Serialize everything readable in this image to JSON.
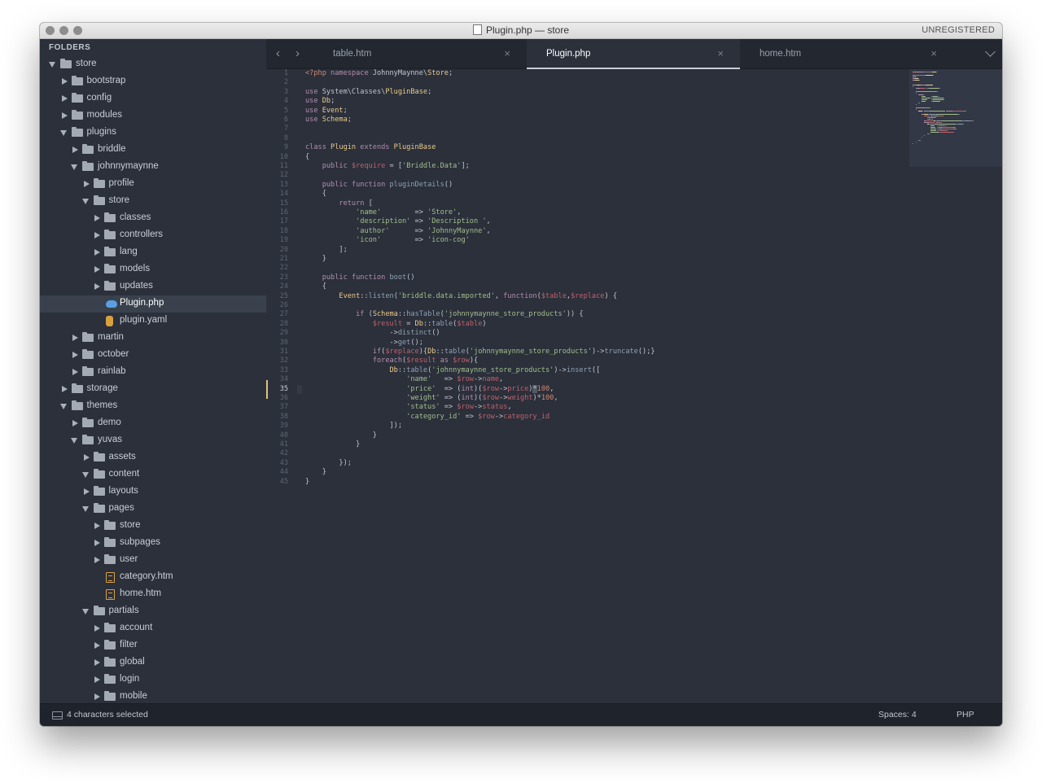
{
  "window": {
    "title": "Plugin.php — store",
    "registration": "UNREGISTERED"
  },
  "sidebar": {
    "header": "FOLDERS",
    "items": [
      {
        "label": "store",
        "depth": 0,
        "kind": "folder",
        "state": "open"
      },
      {
        "label": "bootstrap",
        "depth": 1,
        "kind": "folder",
        "state": "closed"
      },
      {
        "label": "config",
        "depth": 1,
        "kind": "folder",
        "state": "closed"
      },
      {
        "label": "modules",
        "depth": 1,
        "kind": "folder",
        "state": "closed"
      },
      {
        "label": "plugins",
        "depth": 1,
        "kind": "folder",
        "state": "open"
      },
      {
        "label": "briddle",
        "depth": 2,
        "kind": "folder",
        "state": "closed"
      },
      {
        "label": "johnnymaynne",
        "depth": 2,
        "kind": "folder",
        "state": "open"
      },
      {
        "label": "profile",
        "depth": 3,
        "kind": "folder",
        "state": "closed"
      },
      {
        "label": "store",
        "depth": 3,
        "kind": "folder",
        "state": "open"
      },
      {
        "label": "classes",
        "depth": 4,
        "kind": "folder",
        "state": "closed"
      },
      {
        "label": "controllers",
        "depth": 4,
        "kind": "folder",
        "state": "closed"
      },
      {
        "label": "lang",
        "depth": 4,
        "kind": "folder",
        "state": "closed"
      },
      {
        "label": "models",
        "depth": 4,
        "kind": "folder",
        "state": "closed"
      },
      {
        "label": "updates",
        "depth": 4,
        "kind": "folder",
        "state": "closed"
      },
      {
        "label": "Plugin.php",
        "depth": 4,
        "kind": "php",
        "selected": true
      },
      {
        "label": "plugin.yaml",
        "depth": 4,
        "kind": "yaml"
      },
      {
        "label": "martin",
        "depth": 2,
        "kind": "folder",
        "state": "closed"
      },
      {
        "label": "october",
        "depth": 2,
        "kind": "folder",
        "state": "closed"
      },
      {
        "label": "rainlab",
        "depth": 2,
        "kind": "folder",
        "state": "closed"
      },
      {
        "label": "storage",
        "depth": 1,
        "kind": "folder",
        "state": "closed"
      },
      {
        "label": "themes",
        "depth": 1,
        "kind": "folder",
        "state": "open"
      },
      {
        "label": "demo",
        "depth": 2,
        "kind": "folder",
        "state": "closed"
      },
      {
        "label": "yuvas",
        "depth": 2,
        "kind": "folder",
        "state": "open"
      },
      {
        "label": "assets",
        "depth": 3,
        "kind": "folder",
        "state": "closed"
      },
      {
        "label": "content",
        "depth": 3,
        "kind": "folder",
        "state": "open"
      },
      {
        "label": "layouts",
        "depth": 3,
        "kind": "folder",
        "state": "closed"
      },
      {
        "label": "pages",
        "depth": 3,
        "kind": "folder",
        "state": "open"
      },
      {
        "label": "store",
        "depth": 4,
        "kind": "folder",
        "state": "closed"
      },
      {
        "label": "subpages",
        "depth": 4,
        "kind": "folder",
        "state": "closed"
      },
      {
        "label": "user",
        "depth": 4,
        "kind": "folder",
        "state": "closed"
      },
      {
        "label": "category.htm",
        "depth": 4,
        "kind": "htm"
      },
      {
        "label": "home.htm",
        "depth": 4,
        "kind": "htm"
      },
      {
        "label": "partials",
        "depth": 3,
        "kind": "folder",
        "state": "open"
      },
      {
        "label": "account",
        "depth": 4,
        "kind": "folder",
        "state": "closed"
      },
      {
        "label": "filter",
        "depth": 4,
        "kind": "folder",
        "state": "closed"
      },
      {
        "label": "global",
        "depth": 4,
        "kind": "folder",
        "state": "closed"
      },
      {
        "label": "login",
        "depth": 4,
        "kind": "folder",
        "state": "closed"
      },
      {
        "label": "mobile",
        "depth": 4,
        "kind": "folder",
        "state": "closed"
      }
    ]
  },
  "tabs": [
    {
      "label": "table.htm",
      "active": false
    },
    {
      "label": "Plugin.php",
      "active": true
    },
    {
      "label": "home.htm",
      "active": false
    }
  ],
  "icons": {
    "back": "chevron-left-icon",
    "forward": "chevron-right-icon",
    "close": "close-icon",
    "tab_menu": "chevron-down-icon"
  },
  "editor": {
    "current_line": 35,
    "lines": [
      [
        [
          "tg",
          "<?php "
        ],
        [
          "kw",
          "namespace "
        ],
        [
          "op",
          "JohnnyMaynne\\"
        ],
        [
          "cls",
          "Store"
        ],
        [
          "op",
          ";"
        ]
      ],
      [],
      [
        [
          "kw",
          "use "
        ],
        [
          "op",
          "System\\Classes\\"
        ],
        [
          "cls",
          "PluginBase"
        ],
        [
          "op",
          ";"
        ]
      ],
      [
        [
          "kw",
          "use "
        ],
        [
          "cls",
          "Db"
        ],
        [
          "op",
          ";"
        ]
      ],
      [
        [
          "kw",
          "use "
        ],
        [
          "cls",
          "Event"
        ],
        [
          "op",
          ";"
        ]
      ],
      [
        [
          "kw",
          "use "
        ],
        [
          "cls",
          "Schema"
        ],
        [
          "op",
          ";"
        ]
      ],
      [],
      [],
      [
        [
          "kw",
          "class "
        ],
        [
          "cls",
          "Plugin "
        ],
        [
          "kw",
          "extends "
        ],
        [
          "cls",
          "PluginBase"
        ]
      ],
      [
        [
          "op",
          "{"
        ]
      ],
      [
        [
          "op",
          "    "
        ],
        [
          "kw",
          "public "
        ],
        [
          "vr",
          "$require"
        ],
        [
          "op",
          " = ["
        ],
        [
          "st",
          "'Briddle.Data'"
        ],
        [
          "op",
          "];"
        ]
      ],
      [],
      [
        [
          "op",
          "    "
        ],
        [
          "kw",
          "public function "
        ],
        [
          "fn",
          "pluginDetails"
        ],
        [
          "op",
          "()"
        ]
      ],
      [
        [
          "op",
          "    {"
        ]
      ],
      [
        [
          "op",
          "        "
        ],
        [
          "kw",
          "return "
        ],
        [
          "op",
          "["
        ]
      ],
      [
        [
          "op",
          "            "
        ],
        [
          "st",
          "'name'"
        ],
        [
          "op",
          "        => "
        ],
        [
          "st",
          "'Store'"
        ],
        [
          "op",
          ","
        ]
      ],
      [
        [
          "op",
          "            "
        ],
        [
          "st",
          "'description'"
        ],
        [
          "op",
          " => "
        ],
        [
          "st",
          "'Description '"
        ],
        [
          "op",
          ","
        ]
      ],
      [
        [
          "op",
          "            "
        ],
        [
          "st",
          "'author'"
        ],
        [
          "op",
          "      => "
        ],
        [
          "st",
          "'JohnnyMaynne'"
        ],
        [
          "op",
          ","
        ]
      ],
      [
        [
          "op",
          "            "
        ],
        [
          "st",
          "'icon'"
        ],
        [
          "op",
          "        => "
        ],
        [
          "st",
          "'icon-cog'"
        ]
      ],
      [
        [
          "op",
          "        ];"
        ]
      ],
      [
        [
          "op",
          "    }"
        ]
      ],
      [],
      [
        [
          "op",
          "    "
        ],
        [
          "kw",
          "public function "
        ],
        [
          "fn",
          "boot"
        ],
        [
          "op",
          "()"
        ]
      ],
      [
        [
          "op",
          "    {"
        ]
      ],
      [
        [
          "op",
          "        "
        ],
        [
          "cls",
          "Event"
        ],
        [
          "op",
          "::"
        ],
        [
          "fn",
          "listen"
        ],
        [
          "op",
          "("
        ],
        [
          "st",
          "'briddle.data.imported'"
        ],
        [
          "op",
          ", "
        ],
        [
          "kw",
          "function"
        ],
        [
          "op",
          "("
        ],
        [
          "vr",
          "$table"
        ],
        [
          "op",
          ","
        ],
        [
          "vr",
          "$replace"
        ],
        [
          "op",
          ") {"
        ]
      ],
      [],
      [
        [
          "op",
          "            "
        ],
        [
          "kw",
          "if "
        ],
        [
          "op",
          "("
        ],
        [
          "cls",
          "Schema"
        ],
        [
          "op",
          "::"
        ],
        [
          "fn",
          "hasTable"
        ],
        [
          "op",
          "("
        ],
        [
          "st",
          "'johnnymaynne_store_products'"
        ],
        [
          "op",
          ")) {"
        ]
      ],
      [
        [
          "op",
          "                "
        ],
        [
          "vr",
          "$result"
        ],
        [
          "op",
          " = "
        ],
        [
          "cls",
          "Db"
        ],
        [
          "op",
          "::"
        ],
        [
          "fn",
          "table"
        ],
        [
          "op",
          "("
        ],
        [
          "vr",
          "$table"
        ],
        [
          "op",
          ")"
        ]
      ],
      [
        [
          "op",
          "                    ->"
        ],
        [
          "fn",
          "distinct"
        ],
        [
          "op",
          "()"
        ]
      ],
      [
        [
          "op",
          "                    ->"
        ],
        [
          "fn",
          "get"
        ],
        [
          "op",
          "();"
        ]
      ],
      [
        [
          "op",
          "                "
        ],
        [
          "kw",
          "if"
        ],
        [
          "op",
          "("
        ],
        [
          "vr",
          "$replace"
        ],
        [
          "op",
          "){"
        ],
        [
          "cls",
          "Db"
        ],
        [
          "op",
          "::"
        ],
        [
          "fn",
          "table"
        ],
        [
          "op",
          "("
        ],
        [
          "st",
          "'johnnymaynne_store_products'"
        ],
        [
          "op",
          ")->"
        ],
        [
          "fn",
          "truncate"
        ],
        [
          "op",
          "();}"
        ]
      ],
      [
        [
          "op",
          "                "
        ],
        [
          "kw",
          "foreach"
        ],
        [
          "op",
          "("
        ],
        [
          "vr",
          "$result"
        ],
        [
          "kw",
          " as "
        ],
        [
          "vr",
          "$row"
        ],
        [
          "op",
          "){"
        ]
      ],
      [
        [
          "op",
          "                    "
        ],
        [
          "cls",
          "Db"
        ],
        [
          "op",
          "::"
        ],
        [
          "fn",
          "table"
        ],
        [
          "op",
          "("
        ],
        [
          "st",
          "'johnnymaynne_store_products'"
        ],
        [
          "op",
          ")->"
        ],
        [
          "fn",
          "insert"
        ],
        [
          "op",
          "(["
        ]
      ],
      [
        [
          "op",
          "                        "
        ],
        [
          "st",
          "'name'"
        ],
        [
          "op",
          "   => "
        ],
        [
          "vr",
          "$row"
        ],
        [
          "op",
          "->"
        ],
        [
          "vr",
          "name"
        ],
        [
          "op",
          ","
        ]
      ],
      [
        [
          "op",
          "                        "
        ],
        [
          "st",
          "'price'"
        ],
        [
          "op",
          "  => ("
        ],
        [
          "kw",
          "int"
        ],
        [
          "op",
          ")("
        ],
        [
          "vr",
          "$row"
        ],
        [
          "op",
          "->"
        ],
        [
          "vr",
          "price"
        ],
        [
          "op",
          ")"
        ],
        [
          "sel",
          "*"
        ],
        [
          "nm",
          "100"
        ],
        [
          "op",
          ","
        ]
      ],
      [
        [
          "op",
          "                        "
        ],
        [
          "st",
          "'weight'"
        ],
        [
          "op",
          " => ("
        ],
        [
          "kw",
          "int"
        ],
        [
          "op",
          ")("
        ],
        [
          "vr",
          "$row"
        ],
        [
          "op",
          "->"
        ],
        [
          "vr",
          "weight"
        ],
        [
          "op",
          ")*"
        ],
        [
          "nm",
          "100"
        ],
        [
          "op",
          ","
        ]
      ],
      [
        [
          "op",
          "                        "
        ],
        [
          "st",
          "'status'"
        ],
        [
          "op",
          " => "
        ],
        [
          "vr",
          "$row"
        ],
        [
          "op",
          "->"
        ],
        [
          "vr",
          "status"
        ],
        [
          "op",
          ","
        ]
      ],
      [
        [
          "op",
          "                        "
        ],
        [
          "st",
          "'category_id'"
        ],
        [
          "op",
          " => "
        ],
        [
          "vr",
          "$row"
        ],
        [
          "op",
          "->"
        ],
        [
          "vr",
          "category_id"
        ]
      ],
      [
        [
          "op",
          "                    ]);"
        ]
      ],
      [
        [
          "op",
          "                }"
        ]
      ],
      [
        [
          "op",
          "            }"
        ]
      ],
      [],
      [
        [
          "op",
          "        });"
        ]
      ],
      [
        [
          "op",
          "    }"
        ]
      ],
      [
        [
          "op",
          "}"
        ]
      ]
    ]
  },
  "status": {
    "selection": "4 characters selected",
    "indentation": "Spaces: 4",
    "syntax": "PHP"
  },
  "colors": {
    "background": "#2b303b",
    "tabbar": "#222730",
    "statusbar": "#1f232b",
    "accent_cursor": "#e5c07b",
    "keyword": "#b48ead",
    "function": "#8fa1b3",
    "string": "#a3be8c",
    "variable": "#bf616a",
    "class": "#ebcb8b",
    "number": "#d08770"
  }
}
